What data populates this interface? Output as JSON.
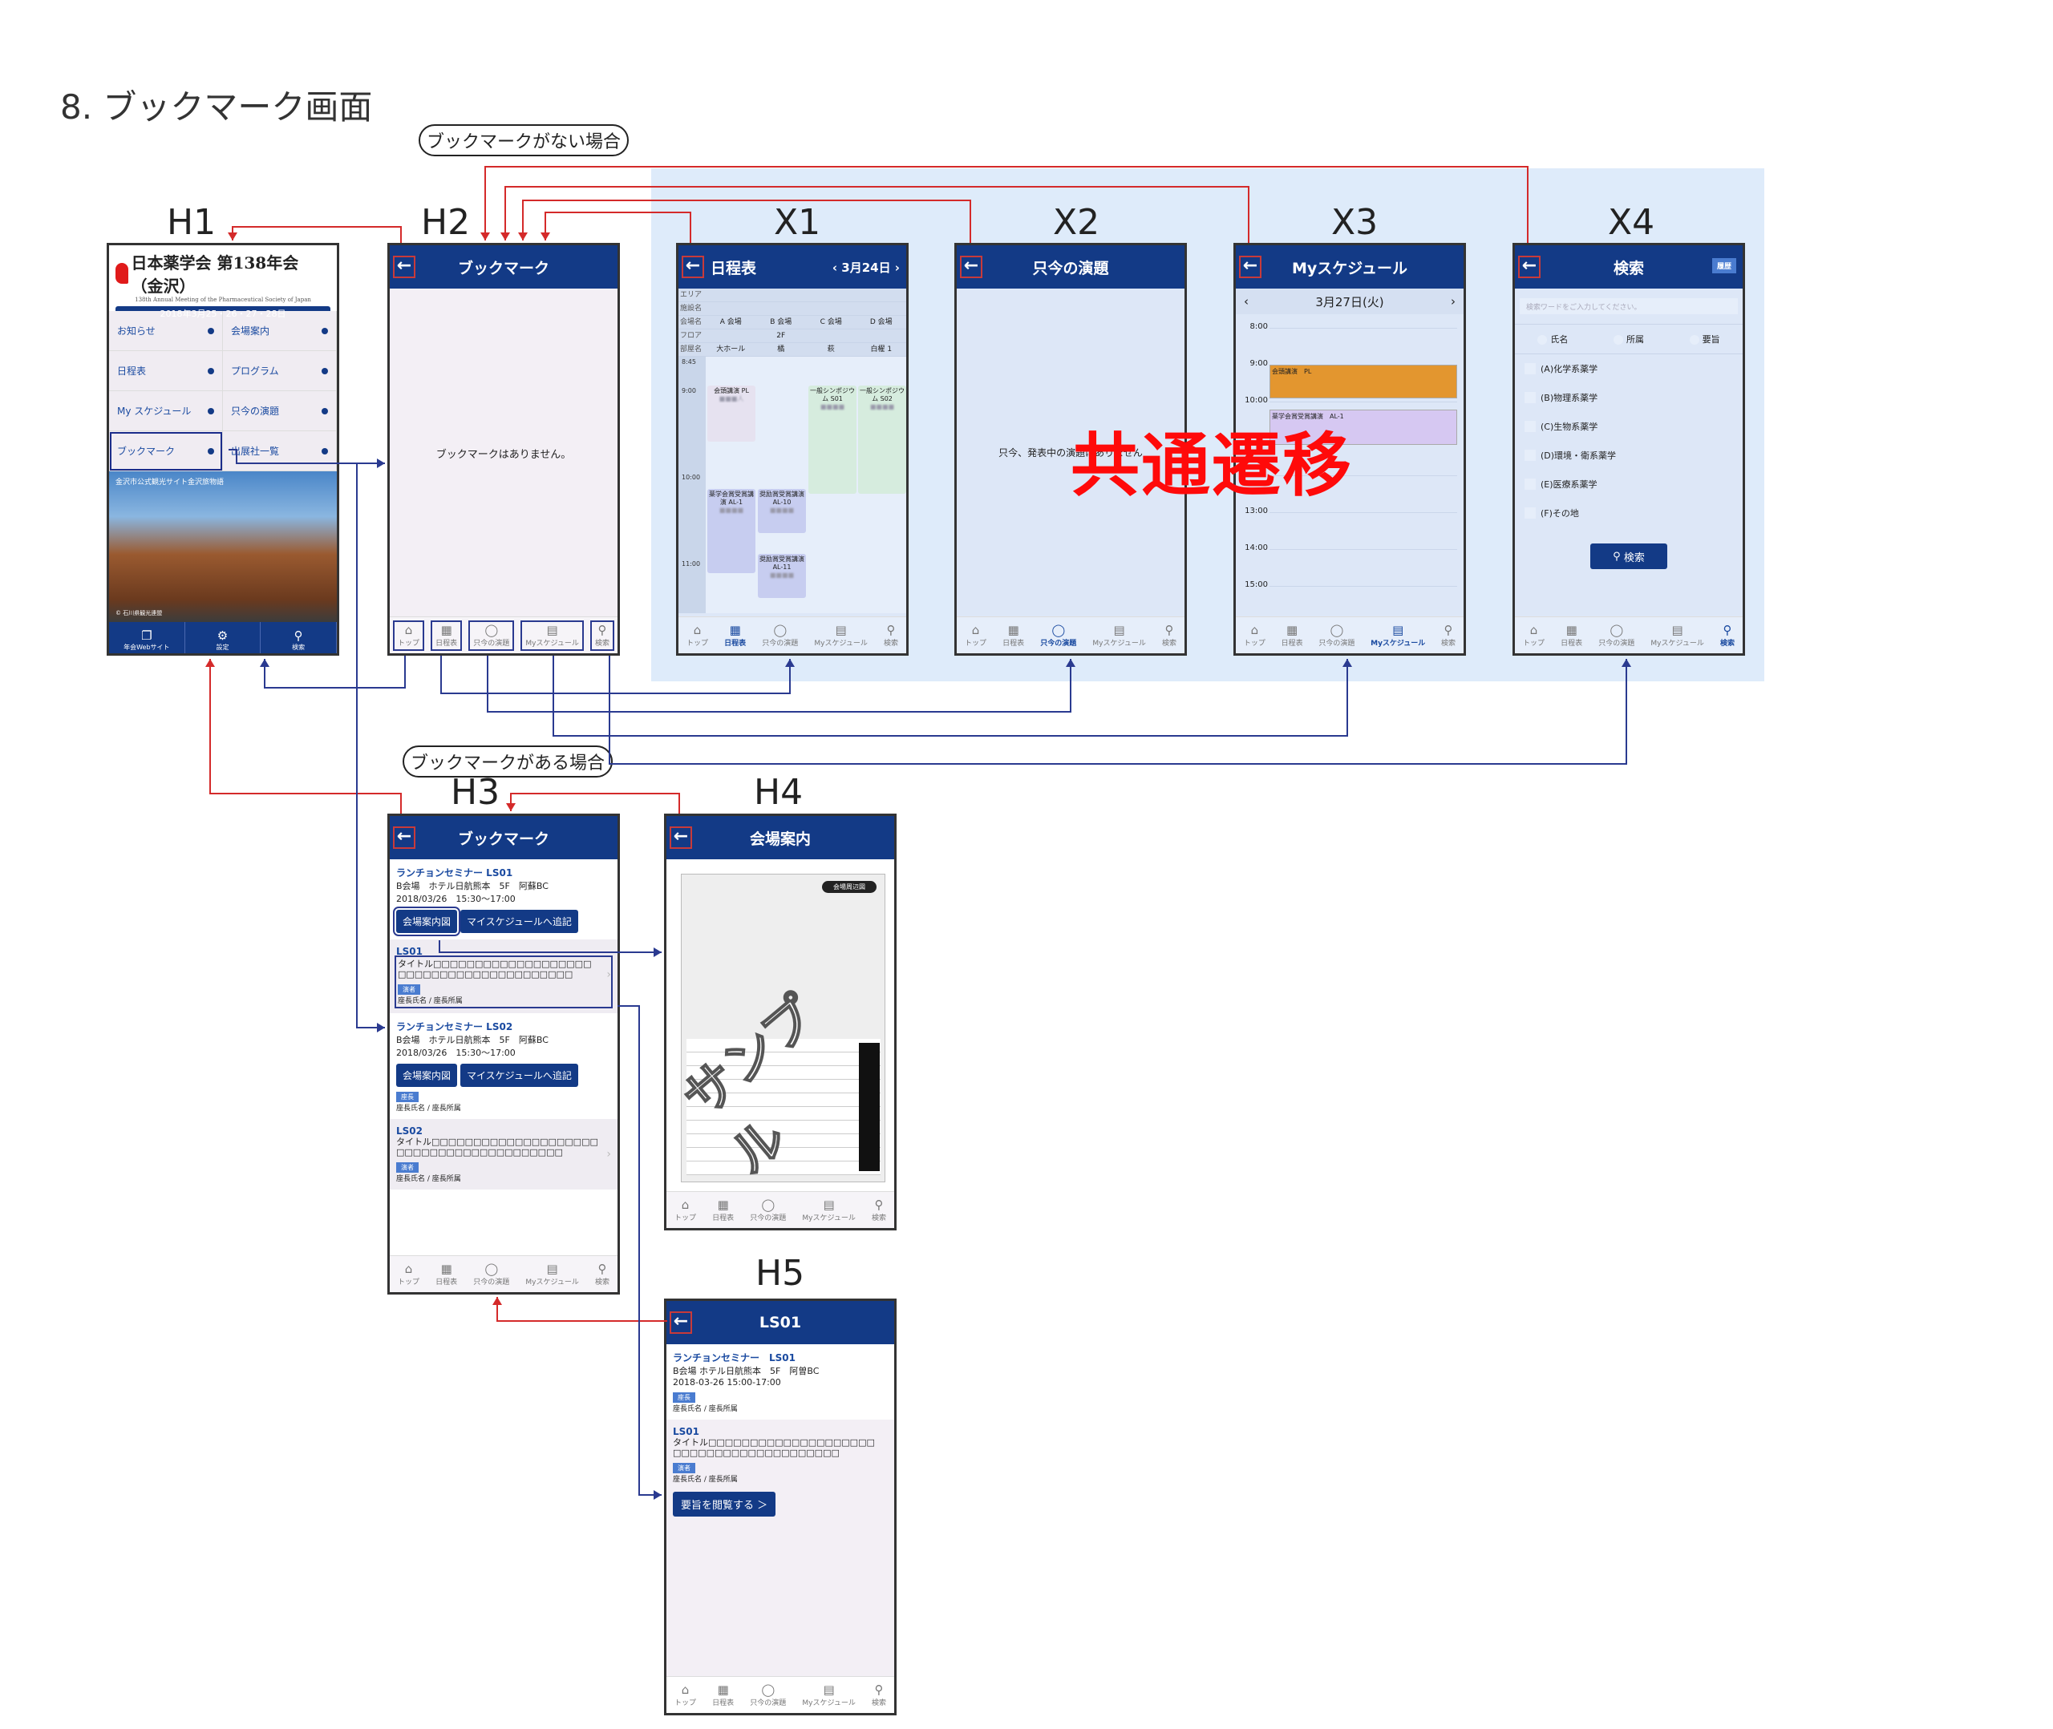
{
  "page": {
    "title": "8. ブックマーク画面",
    "case_no_bookmark": "ブックマークがない場合",
    "case_has_bookmark": "ブックマークがある場合",
    "common_transition": "共通遷移"
  },
  "labels": {
    "h1": "H1",
    "h2": "H2",
    "h3": "H3",
    "h4": "H4",
    "h5": "H5",
    "x1": "X1",
    "x2": "X2",
    "x3": "X3",
    "x4": "X4"
  },
  "tabbar": [
    {
      "label": "トップ",
      "icon": "home-icon",
      "glyph": "⌂"
    },
    {
      "label": "日程表",
      "icon": "calendar-clock-icon",
      "glyph": "▦"
    },
    {
      "label": "只今の演題",
      "icon": "speech-bubble-icon",
      "glyph": "◯"
    },
    {
      "label": "Myスケジュール",
      "icon": "schedule-grid-icon",
      "glyph": "▤"
    },
    {
      "label": "検索",
      "icon": "search-icon",
      "glyph": "⚲"
    }
  ],
  "h1": {
    "logo_title": "日本薬学会 第138年会（金沢）",
    "logo_subtitle": "138th Annual Meeting of the Pharmaceutical Society of Japan",
    "dates": "2018年3月25・26・27・28日",
    "menu": [
      "お知らせ",
      "会場案内",
      "日程表",
      "プログラム",
      "My スケジュール",
      "只今の演題",
      "ブックマーク",
      "出展社一覧"
    ],
    "photo_caption": "金沢市公式観光サイト金沢旅物語",
    "photo_credit": "© 石川県観光連盟",
    "bottom_bar": [
      {
        "label": "年会Webサイト",
        "icon": "window-icon",
        "glyph": "❐"
      },
      {
        "label": "設定",
        "icon": "gear-icon",
        "glyph": "⚙"
      },
      {
        "label": "検索",
        "icon": "search-icon",
        "glyph": "⚲"
      }
    ]
  },
  "h2": {
    "title": "ブックマーク",
    "empty_message": "ブックマークはありません。"
  },
  "x1": {
    "title": "日程表",
    "date": "‹ 3月24日 ›",
    "header_rows": [
      [
        "エリア",
        "",
        "",
        "",
        ""
      ],
      [
        "施設名",
        "",
        "",
        "",
        ""
      ],
      [
        "会場名",
        "A 会場",
        "B 会場",
        "C 会場",
        "D 会場"
      ],
      [
        "フロア",
        "",
        "2F",
        "",
        ""
      ],
      [
        "部屋名",
        "大ホール",
        "橘",
        "萩",
        "白櫂 1"
      ]
    ],
    "times": [
      "8:45",
      "9:00",
      "10:00",
      "11:00"
    ],
    "events": [
      {
        "title": "会頭講演 PL",
        "who": "■■■人"
      },
      {
        "title": "一般シンポジウム S01",
        "who": "■■■■"
      },
      {
        "title": "一般シンポジウム S02",
        "who": "■■■■"
      },
      {
        "title": "薬学会賞受賞講演 AL-1",
        "who": "■■■■"
      },
      {
        "title": "奨励賞受賞講演 AL-10",
        "who": "■■■■"
      },
      {
        "title": "奨励賞受賞講演 AL-11",
        "who": "■■■■"
      }
    ]
  },
  "x2": {
    "title": "只今の演題",
    "message": "只今、発表中の演題はありません"
  },
  "x3": {
    "title": "Myスケジュール",
    "date": "3月27日(火)",
    "times": [
      "8:00",
      "9:00",
      "10:00",
      "11:00",
      "12:00",
      "13:00",
      "14:00",
      "15:00"
    ],
    "events": [
      {
        "label": "会頭講演　PL",
        "color": "#e3962f"
      },
      {
        "label": "薬学会賞受賞講演　AL-1",
        "color": "#d6c8f2"
      }
    ]
  },
  "x4": {
    "title": "検索",
    "history_button": "履歴",
    "search_placeholder": "検索ワードをご入力してください。",
    "radios": [
      "氏名",
      "所属",
      "要旨"
    ],
    "categories": [
      "(A)化学系薬学",
      "(B)物理系薬学",
      "(C)生物系薬学",
      "(D)環境・衛系薬学",
      "(E)医療系薬学",
      "(F)その地"
    ],
    "search_button": "検索"
  },
  "h3": {
    "title": "ブックマーク",
    "sessions": [
      {
        "title": "ランチョンセミナー LS01",
        "venue": "B会場　ホテル日航熊本　5F　阿蘇BC",
        "datetime": "2018/03/26　15:30〜17:00",
        "map_button": "会場案内図",
        "add_button": "マイスケジュールへ追記",
        "role_badge": "",
        "role_text": "",
        "presentation": {
          "code": "LS01",
          "title": "タイトル□□□□□□□□□□□□□□□□□□□□□□□□□□□□□□□□□□□□□□□□",
          "badge": "演者",
          "person": "座長氏名 / 座長所属"
        }
      },
      {
        "title": "ランチョンセミナー LS02",
        "venue": "B会場　ホテル日航熊本　5F　阿蘇BC",
        "datetime": "2018/03/26　15:30〜17:00",
        "map_button": "会場案内図",
        "add_button": "マイスケジュールへ追記",
        "role_badge": "座長",
        "role_text": "座長氏名 / 座長所属",
        "presentation": {
          "code": "LS02",
          "title": "タイトル□□□□□□□□□□□□□□□□□□□□□□□□□□□□□□□□□□□□□□□□",
          "badge": "演者",
          "person": "座長氏名 / 座長所属"
        }
      }
    ]
  },
  "h4": {
    "title": "会場案内",
    "map_label": "会場周辺図",
    "watermark": "サンプル"
  },
  "h5": {
    "title": "LS01",
    "session_title": "ランチョンセミナー　LS01",
    "venue": "B会場 ホテル日航熊本　5F　阿曽BC",
    "datetime": "2018-03-26 15:00-17:00",
    "role_badge": "座長",
    "role_text": "座長氏名 / 座長所属",
    "presentation": {
      "code": "LS01",
      "title": "タイトル□□□□□□□□□□□□□□□□□□□□□□□□□□□□□□□□□□□□□□□□",
      "badge": "演者",
      "person": "座長氏名 / 座長所属"
    },
    "read_button": "要旨を閲覧する ＞"
  },
  "colors": {
    "header_blue": "#133a86",
    "flow_red": "#d42a2a",
    "flow_blue": "#2a3a90",
    "common_bg": "#deebfa",
    "stamp_red": "#ff0a0a"
  }
}
